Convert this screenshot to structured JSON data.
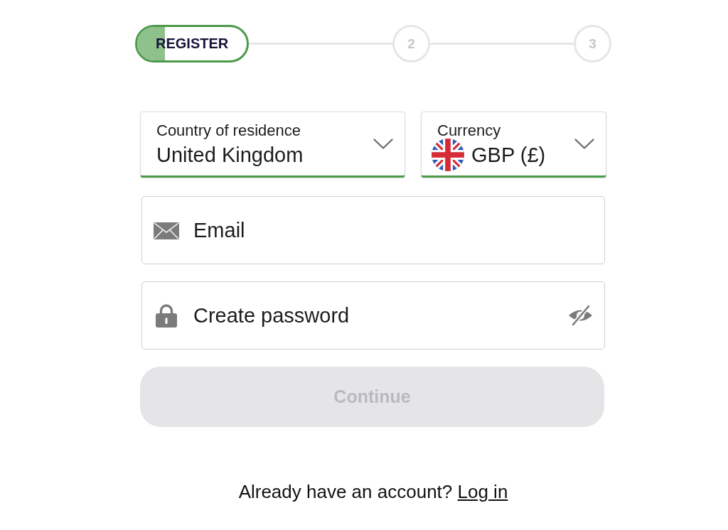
{
  "stepper": {
    "steps": [
      {
        "label": "REGISTER",
        "selected": true,
        "level": 0.25
      },
      {
        "label": "2",
        "selected": false
      },
      {
        "label": "3",
        "selected": false
      }
    ]
  },
  "form": {
    "country": {
      "label": "Country of residence",
      "value": "United Kingdom",
      "valid": true
    },
    "currency": {
      "label": "Currency",
      "value": "GBP (£)",
      "valid": true
    },
    "email": {
      "placeholder": "Email"
    },
    "password": {
      "placeholder": "Create password"
    },
    "continue_button": {
      "label": "Continue",
      "disabled": true
    }
  },
  "footer": {
    "text": "Already have an account?",
    "link": "Log in"
  }
}
